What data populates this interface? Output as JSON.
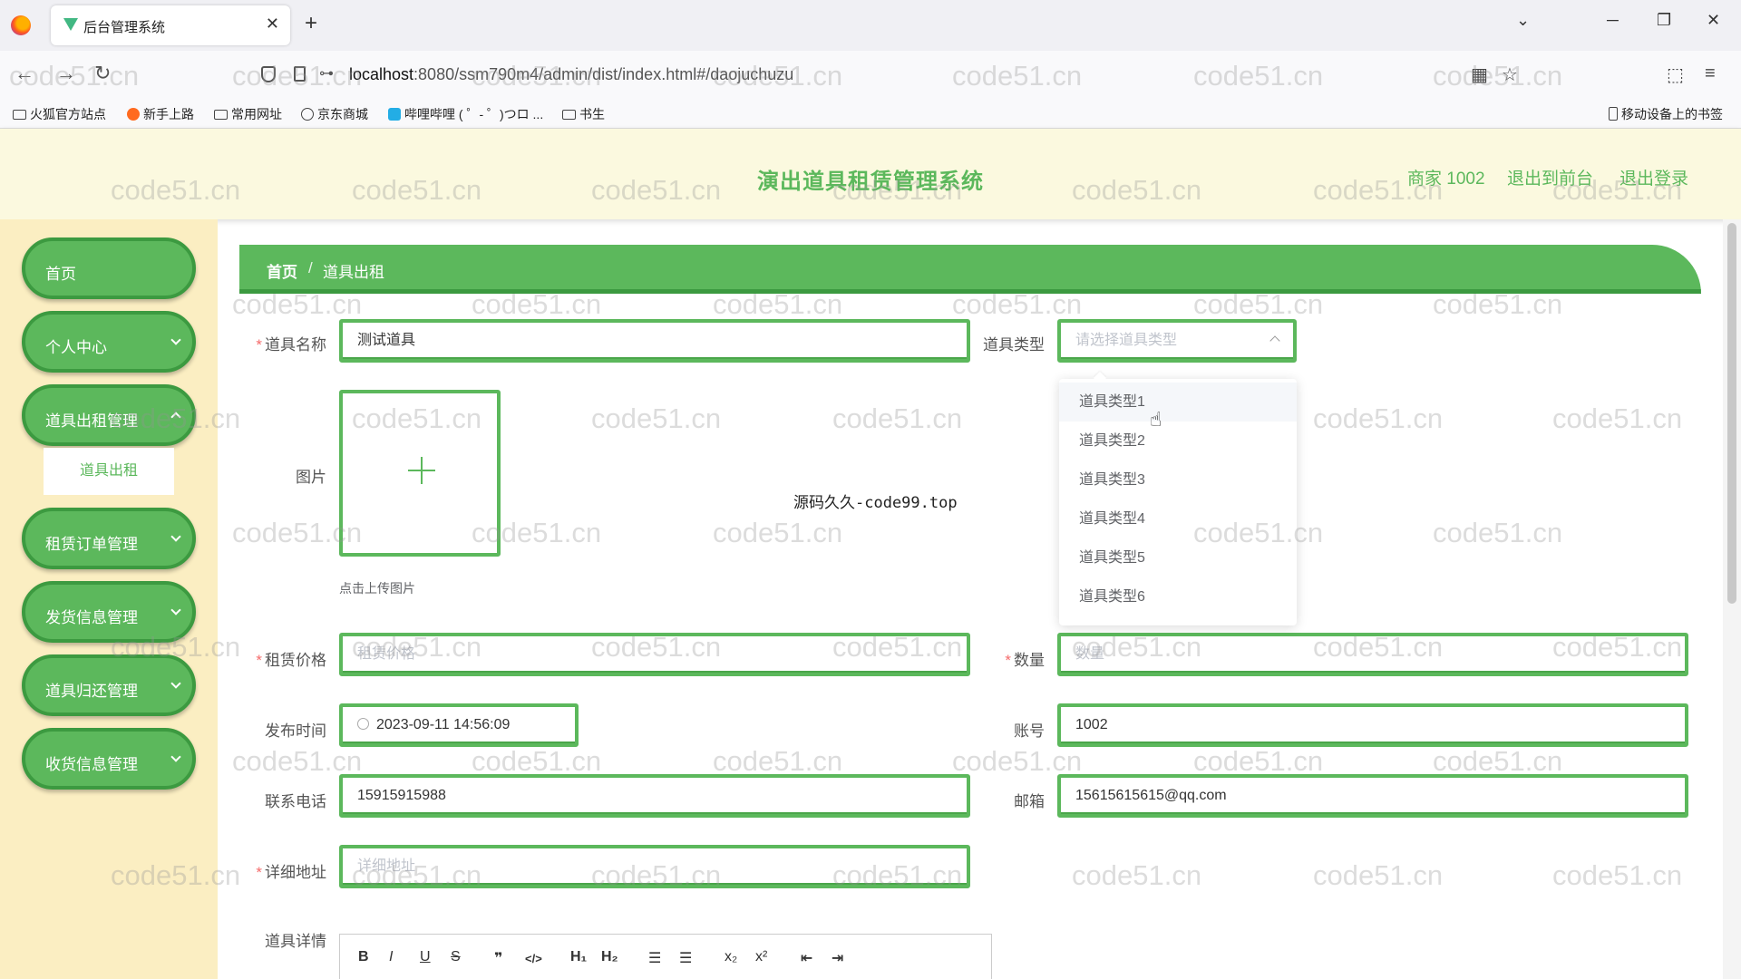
{
  "browser": {
    "tab_title": "后台管理系统",
    "url_host": "localhost",
    "url_rest": ":8080/ssm790m4/admin/dist/index.html#/daojuchuzu",
    "bookmarks": [
      "火狐官方站点",
      "新手上路",
      "常用网址",
      "京东商城",
      "哔哩哔哩 ( ゜- ゜)つロ ...",
      "书生"
    ],
    "mobile_bookmarks": "移动设备上的书签"
  },
  "header": {
    "title": "演出道具租赁管理系统",
    "user": "商家 1002",
    "to_front": "退出到前台",
    "logout": "退出登录"
  },
  "sidebar": {
    "items": [
      "首页",
      "个人中心",
      "道具出租管理",
      "租赁订单管理",
      "发货信息管理",
      "道具归还管理",
      "收货信息管理"
    ],
    "sub_item": "道具出租"
  },
  "breadcrumb": {
    "home": "首页",
    "sep": "/",
    "current": "道具出租"
  },
  "form": {
    "name_label": "道具名称",
    "name_value": "测试道具",
    "type_label": "道具类型",
    "type_placeholder": "请选择道具类型",
    "image_label": "图片",
    "upload_hint": "点击上传图片",
    "price_label": "租赁价格",
    "price_placeholder": "租赁价格",
    "qty_label": "数量",
    "qty_placeholder": "数量",
    "time_label": "发布时间",
    "time_value": "2023-09-11 14:56:09",
    "account_label": "账号",
    "account_value": "1002",
    "phone_label": "联系电话",
    "phone_value": "15915915988",
    "email_label": "邮箱",
    "email_value": "15615615615@qq.com",
    "address_label": "详细地址",
    "address_placeholder": "详细地址",
    "detail_label": "道具详情"
  },
  "dropdown": {
    "options": [
      "道具类型1",
      "道具类型2",
      "道具类型3",
      "道具类型4",
      "道具类型5",
      "道具类型6"
    ]
  },
  "overlay_text": "源码久久-code99.top",
  "watermark": "code51.cn",
  "colors": {
    "accent": "#5cb85c",
    "accent_dark": "#3c9a40",
    "sidebar_bg": "#fbeec2",
    "header_bg": "#fbf9df"
  }
}
